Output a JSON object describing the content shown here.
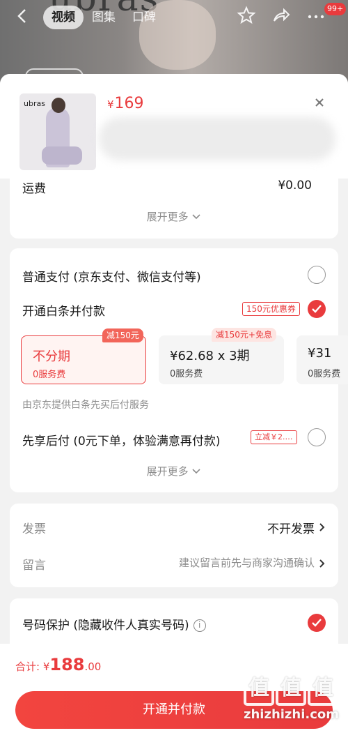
{
  "nav": {
    "back_icon": "chevron-left-icon",
    "tabs": [
      "视频",
      "图集",
      "口碑"
    ],
    "active_tab": 0,
    "badge": "99+",
    "bg_brand": "ubras"
  },
  "product": {
    "thumb_brand": "ubras",
    "price_symbol": "¥",
    "price": "169"
  },
  "shipping": {
    "label": "运费",
    "value": "¥0.00",
    "expand_more": "展开更多"
  },
  "payment": {
    "normal_label": "普通支付 (京东支付、微信支付等)",
    "baitiao_label": "开通白条并付款",
    "baitiao_coupon": "150元优惠券",
    "plans": [
      {
        "main": "不分期",
        "sub": "0服务费",
        "tag": "减150元",
        "selected": true
      },
      {
        "main": "¥62.68 x 3期",
        "sub": "0服务费",
        "tag": "减150元+免息",
        "selected": false
      },
      {
        "main": "¥31",
        "sub": "0服务费",
        "tag": "",
        "selected": false
      }
    ],
    "provider_note": "由京东提供白条先买后付服务",
    "later_label": "先享后付 (0元下单，体验满意再付款)",
    "later_tag": "立减￥2.…",
    "expand_more": "展开更多"
  },
  "invoice": {
    "label": "发票",
    "value": "不开发票",
    "note_label": "留言",
    "note_placeholder": "建议留言前先与商家沟通确认"
  },
  "privacy": {
    "label": "号码保护 (隐藏收件人真实号码)"
  },
  "footer": {
    "total_label": "合计:",
    "total_symbol": "¥",
    "total_int": "188",
    "total_dec": ".00",
    "pay_button": "开通并付款"
  },
  "watermark": {
    "logo_chars": [
      "值",
      "值",
      "值"
    ],
    "site": "zhizhizhi.com"
  },
  "colors": {
    "accent": "#e93b3d",
    "background": "#f2f2f2"
  }
}
